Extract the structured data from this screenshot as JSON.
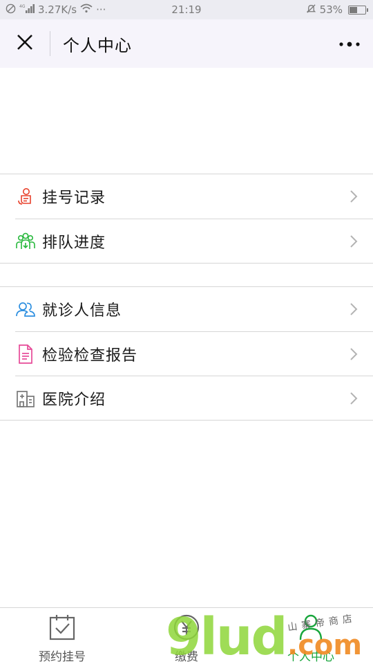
{
  "status_bar": {
    "speed": "3.27K/s",
    "time": "21:19",
    "battery": "53%",
    "battery_level": 0.53,
    "dots": "···"
  },
  "header": {
    "title": "个人中心"
  },
  "menu": {
    "group1": [
      {
        "label": "挂号记录",
        "icon": "registration-record-icon",
        "color": "#e8412c"
      },
      {
        "label": "排队进度",
        "icon": "queue-people-icon",
        "color": "#27b83c"
      }
    ],
    "group2": [
      {
        "label": "就诊人信息",
        "icon": "patients-icon",
        "color": "#2d8fe0"
      },
      {
        "label": "检验检查报告",
        "icon": "report-document-icon",
        "color": "#e64a98"
      },
      {
        "label": "医院介绍",
        "icon": "hospital-building-icon",
        "color": "#777777"
      }
    ]
  },
  "tabbar": {
    "tabs": [
      {
        "label": "预约挂号",
        "icon": "calendar-check-icon",
        "active": false
      },
      {
        "label": "缴费",
        "icon": "yen-coin-icon",
        "active": false
      },
      {
        "label": "个人中心",
        "icon": "person-icon",
        "active": true
      }
    ]
  },
  "watermark": {
    "brand": "9lud",
    "domain": ".com",
    "tagline": "山寨帝商店"
  },
  "colors": {
    "accent": "#18a63c",
    "header_bg": "#f6f4fb",
    "divider": "#d6d6d6"
  }
}
